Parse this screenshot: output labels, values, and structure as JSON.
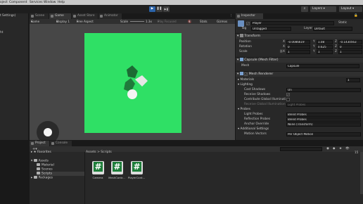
{
  "menubar": [
    "oject",
    "Component",
    "Services",
    "Window",
    "Help"
  ],
  "toolbar": {
    "play": "▶",
    "pause": "❚❚",
    "step": "▶❚",
    "layers": "Layers",
    "layout": "Layout"
  },
  "hierarchy": {
    "items": [
      "t Settings)",
      "ht"
    ]
  },
  "tabs": {
    "scene": "Scene",
    "game": "Game",
    "asset_store": "Asset Store",
    "animator": "Animator",
    "inspector": "Inspector"
  },
  "gamebar": {
    "display_mode": "Game",
    "display": "Display 1",
    "aspect": "Free Aspect",
    "scale_label": "Scale",
    "scale_value": "1.3x",
    "play_mode": "Play Focused",
    "stats": "Stats",
    "gizmos": "Gizmos"
  },
  "inspector": {
    "object_name": "Player",
    "static_label": "Static",
    "tag_label": "Tag",
    "tag_value": "Untagged",
    "layer_label": "Layer",
    "layer_value": "Default",
    "transform": {
      "title": "Transform",
      "position_label": "Position",
      "rotation_label": "Rotation",
      "scale_label": "Scale",
      "position": {
        "x": "-0.0086619",
        "y": "1.08",
        "z": "-0.1430563"
      },
      "rotation": {
        "x": "0",
        "y": "0.625",
        "z": "0"
      },
      "scale": {
        "x": "1",
        "y": "1",
        "z": "1"
      }
    },
    "mesh_filter": {
      "title": "Capsule (Mesh Filter)",
      "mesh_label": "Mesh",
      "mesh_value": "Capsule"
    },
    "mesh_renderer": {
      "title": "Mesh Renderer",
      "materials_label": "Materials",
      "materials_count": "1",
      "lighting_label": "Lighting",
      "cast_shadows_label": "Cast Shadows",
      "cast_shadows_value": "On",
      "receive_shadows_label": "Receive Shadows",
      "contribute_gi_label": "Contribute Global Illuminati",
      "receive_gi_label": "Receive Global Illumination",
      "receive_gi_value": "Light Probes",
      "probes_label": "Probes",
      "light_probes_label": "Light Probes",
      "light_probes_value": "Blend Probes",
      "reflection_probes_label": "Reflection Probes",
      "reflection_probes_value": "Blend Probes",
      "anchor_override_label": "Anchor Override",
      "anchor_override_value": "None (Transform)",
      "additional_settings_label": "Additional Settings",
      "motion_vectors_label": "Motion Vectors",
      "motion_vectors_value": "Per Object Motion"
    }
  },
  "bottom": {
    "project_tab": "Project",
    "console_tab": "Console",
    "favorites": "Favorites",
    "tree": [
      "Assets",
      "Material",
      "Scenes",
      "Scripts",
      "Packages"
    ],
    "breadcrumb": "Assets > Scripts",
    "count": "15",
    "files": [
      "Camera",
      "MeshContr...",
      "PlayerCont..."
    ]
  },
  "colors": {
    "accent_blue": "#2b63a8",
    "green_plane": "#2fe065",
    "script_icon": "#1e7e3a"
  }
}
